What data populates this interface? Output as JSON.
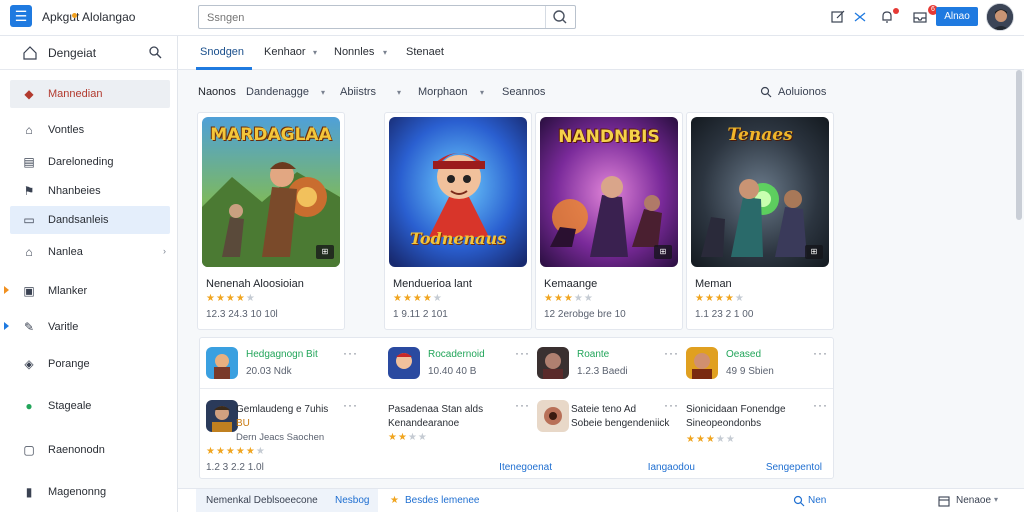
{
  "app": {
    "title": "Apkgut Alolangao",
    "menu_glyph": "☰",
    "search_placeholder": "Ssngen",
    "action_button": "Alnao",
    "notification_count": "6"
  },
  "colors": {
    "accent": "#1f7ae0",
    "green": "#22a55a",
    "star": "#f0a520",
    "orange_marker": "#f09020",
    "blue_marker": "#1f7ae0"
  },
  "sidebar": {
    "header_label": "Dengeiat",
    "items": [
      {
        "label": "Mannedian",
        "icon": "app-icon",
        "glyph": "◆",
        "active": true,
        "color": "#c0392b"
      },
      {
        "label": "Vontles",
        "icon": "home-icon",
        "glyph": "⌂"
      },
      {
        "label": "Dareloneding",
        "icon": "document-icon",
        "glyph": "▤"
      },
      {
        "label": "Nhanbeies",
        "icon": "flag-icon",
        "glyph": "⚑"
      },
      {
        "label": "Dandsanleis",
        "icon": "folder-icon",
        "glyph": "▭",
        "highlight": true
      },
      {
        "label": "Nanlea",
        "icon": "home-icon",
        "glyph": "⌂",
        "chevron": "›"
      },
      {
        "label": "Mlanker",
        "icon": "square-icon",
        "glyph": "▣",
        "marker": "orange"
      },
      {
        "label": "Varitle",
        "icon": "edit-icon",
        "glyph": "✎",
        "marker": "blue"
      },
      {
        "label": "Porange",
        "icon": "shield-icon",
        "glyph": "◈"
      },
      {
        "label": "Stageale",
        "icon": "chat-icon",
        "glyph": "●",
        "green": true
      },
      {
        "label": "Raenonodn",
        "icon": "message-icon",
        "glyph": "▢"
      },
      {
        "label": "Magenonng",
        "icon": "chart-icon",
        "glyph": "▮"
      }
    ]
  },
  "tabs": [
    {
      "label": "Snodgen",
      "active": true
    },
    {
      "label": "Kenhaor",
      "chevron": true
    },
    {
      "label": "Nonnles",
      "chevron": true
    },
    {
      "label": "Stenaet"
    }
  ],
  "filters": {
    "items": [
      "Naonos",
      "Dandenagge",
      "Abiistrs",
      "Morphaon",
      "Seannos"
    ],
    "right_label": "Aoluionos"
  },
  "featured": [
    {
      "name": "Nenenah Aloosioian",
      "art_title": "MARDAGLAA",
      "stars": 4,
      "meta": "12.3 24.3 10 10l",
      "badge": "⊞"
    },
    {
      "name": "Menduerioa lant",
      "art_title": "Todnenaus",
      "stars": 4,
      "meta": "1 9.11 2 101",
      "badge": "⊞"
    },
    {
      "name": "Kemaange",
      "art_title": "NANDNBIS",
      "stars": 3,
      "meta": "12 2erobge bre 10",
      "badge": "⊞"
    },
    {
      "name": "Meman",
      "art_title": "Tenaes",
      "stars": 4,
      "meta": "1.1 23 2 1 00",
      "badge": "⊞"
    }
  ],
  "list_top": [
    {
      "title": "Hedgagnogn Bit",
      "sub": "20.03 Ndk",
      "color": "green"
    },
    {
      "title": "Rocadernoid",
      "sub": "10.40 40 B",
      "color": "green"
    },
    {
      "title": "Roante",
      "sub": "1.2.3 Baedi",
      "color": "green"
    },
    {
      "title": "Oeased",
      "sub": "49 9 Sbien",
      "color": "green"
    }
  ],
  "list_bottom": [
    {
      "title": "Gemlaudeng e 7uhis",
      "title2": "BU",
      "sub": "Dern Jeacs Saochen",
      "stars": 5,
      "meta": "1.2 3 2.2 1.0l",
      "link": ""
    },
    {
      "title": "Pasadenaa Stan alds",
      "title2": "Kenandearanoe",
      "sub": "",
      "stars": 2,
      "meta": "",
      "link": "Itenegoenat"
    },
    {
      "title": "Sateie teno Ad",
      "title2": "Sobeie bengendeniick",
      "sub": "",
      "stars": 0,
      "meta": "",
      "link": "Iangaodou"
    },
    {
      "title": "Sionicidaan Fonendge",
      "title2": "Sineopeondonbs",
      "sub": "",
      "stars": 3,
      "meta": "",
      "link": "Sengepentol"
    }
  ],
  "footer": {
    "left": "Nemenkal Deblsoeecone",
    "left_link": "Nesbog",
    "center": "Besdes lemenee",
    "right_link": "Nen",
    "far_right": "Nenaoe"
  }
}
